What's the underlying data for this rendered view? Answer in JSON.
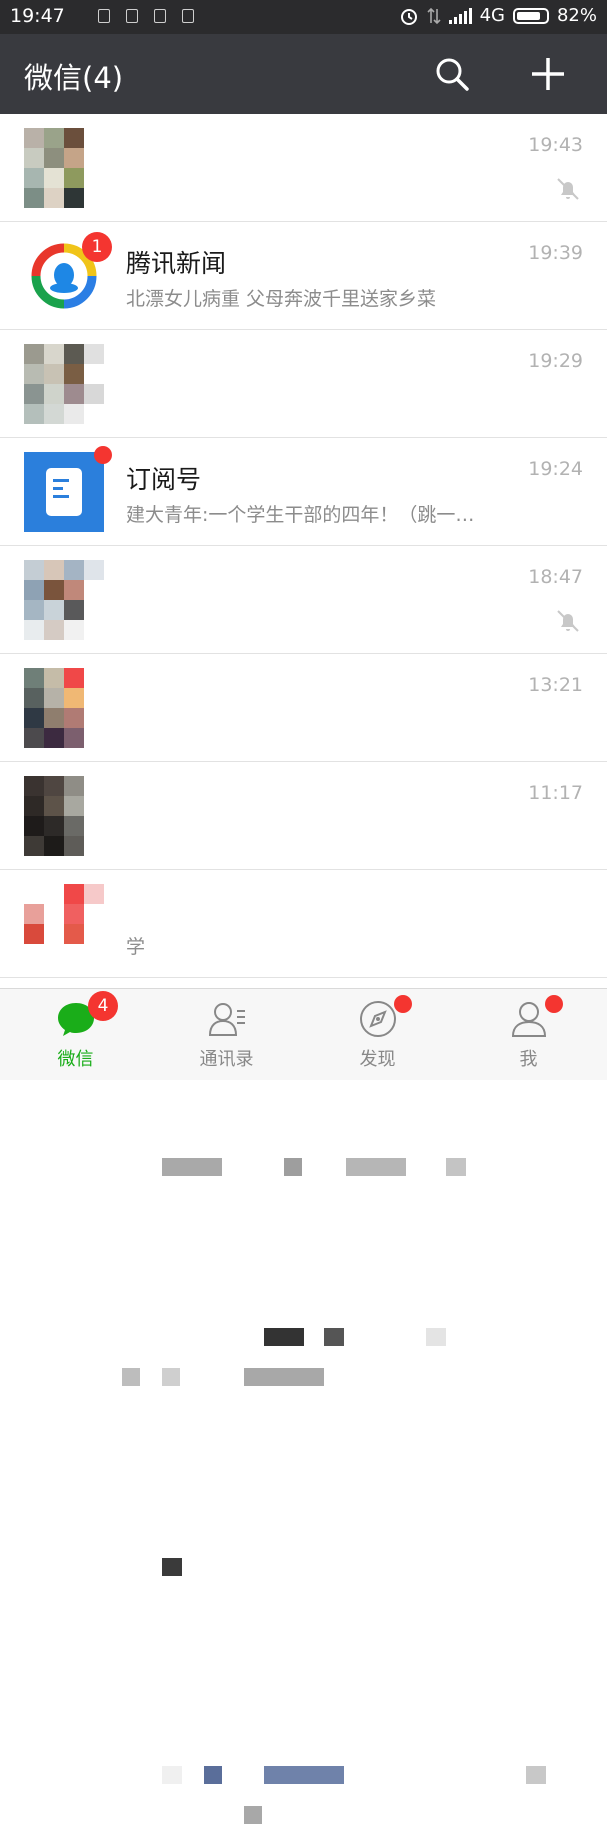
{
  "status_bar": {
    "time": "19:47",
    "network": "4G",
    "battery_text": "82%",
    "battery_level": 0.82
  },
  "header": {
    "title": "微信(4)",
    "icons": [
      "search-icon",
      "plus-icon"
    ]
  },
  "chats": [
    {
      "name": "",
      "preview": "",
      "time": "19:43",
      "muted": true
    },
    {
      "name": "腾讯新闻",
      "preview": "北漂女儿病重 父母奔波千里送家乡菜",
      "time": "19:39",
      "unread": "1"
    },
    {
      "name": "",
      "preview": "",
      "time": "19:29"
    },
    {
      "name": "订阅号",
      "preview": "建大青年:一个学生干部的四年！（跳一…",
      "time": "19:24",
      "dot": true
    },
    {
      "name": "",
      "preview": "",
      "time": "18:47",
      "muted": true
    },
    {
      "name": "",
      "preview": "",
      "time": "13:21"
    },
    {
      "name": "",
      "preview": "",
      "time": "11:17"
    },
    {
      "name": "",
      "preview": "学",
      "time": ""
    }
  ],
  "tabs": [
    {
      "label": "微信",
      "badge": "4",
      "icon": "chat-icon",
      "active": true
    },
    {
      "label": "通讯录",
      "icon": "contacts-icon"
    },
    {
      "label": "发现",
      "icon": "compass-icon",
      "dot": true
    },
    {
      "label": "我",
      "icon": "person-icon",
      "dot": true
    }
  ],
  "colors": {
    "header_bg": "#393a3f",
    "status_bg": "#2b2b2d",
    "accent_green": "#1aad19",
    "badge_red": "#f43530"
  }
}
